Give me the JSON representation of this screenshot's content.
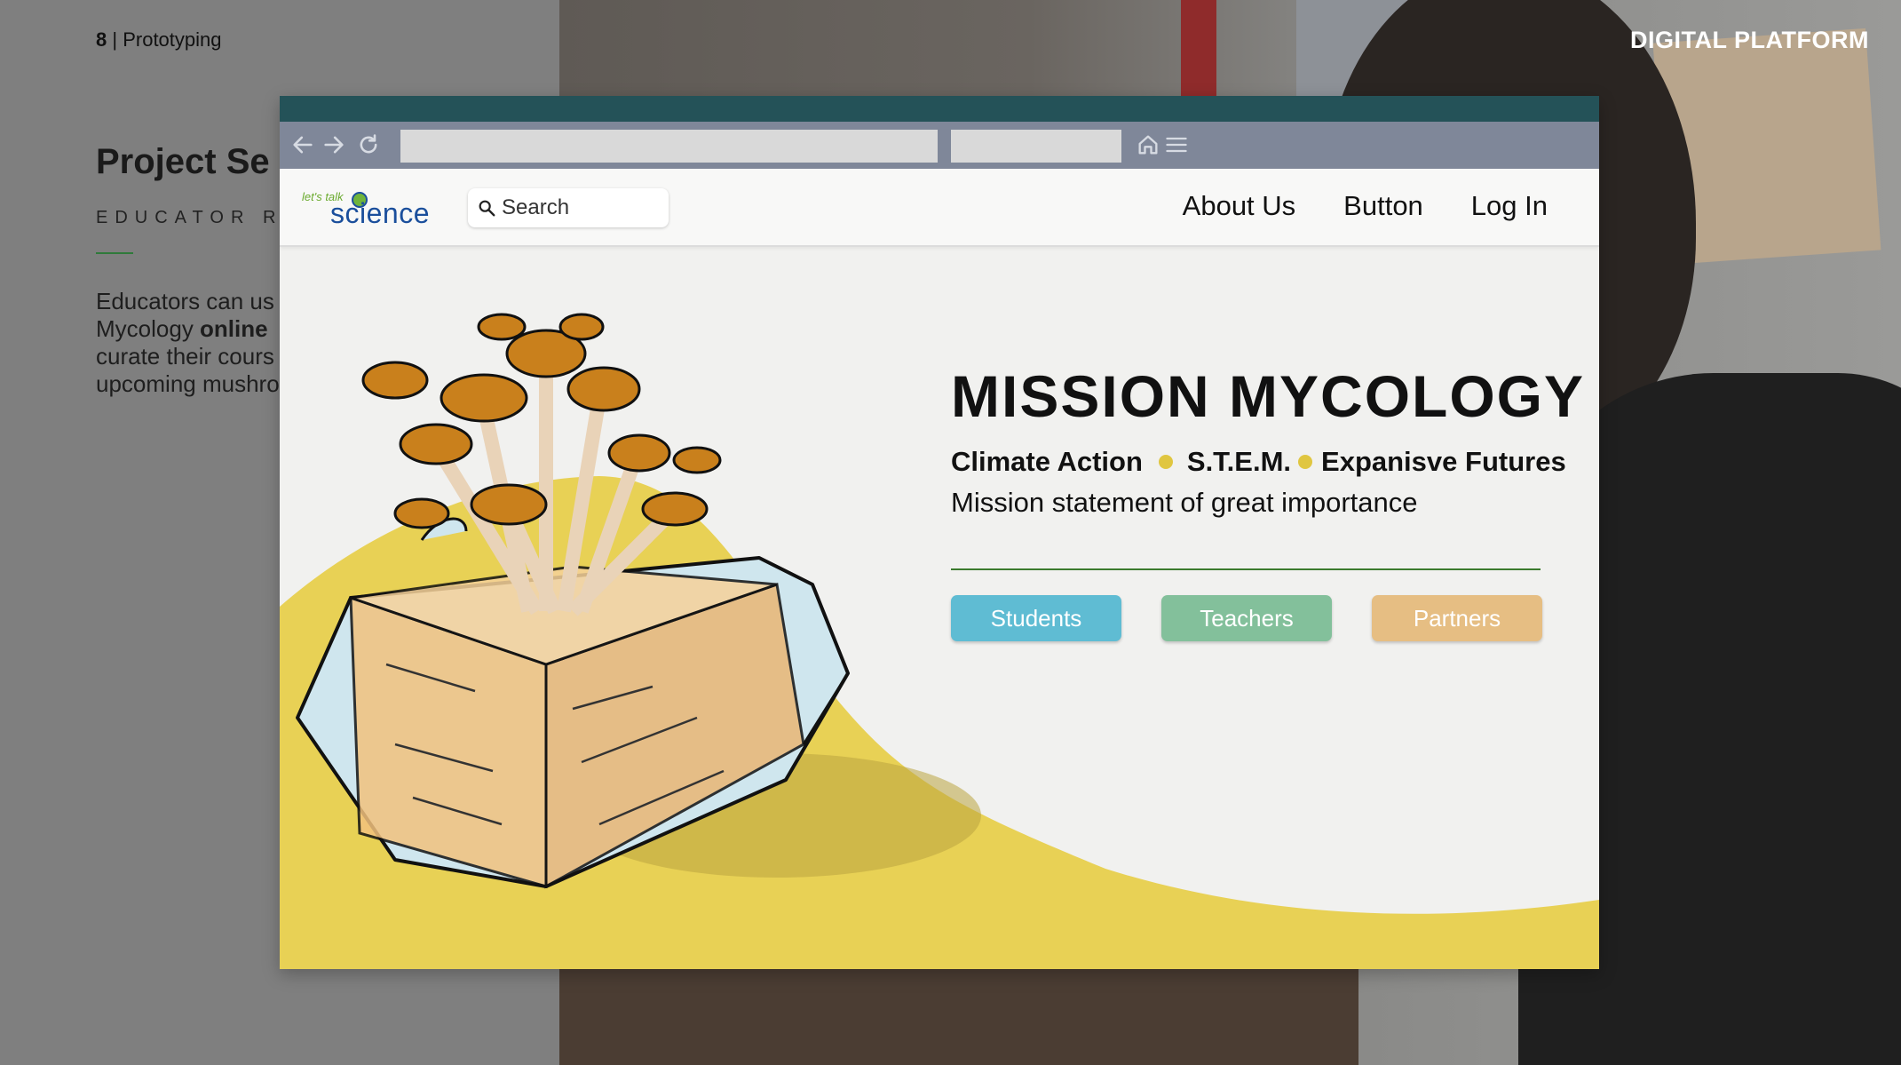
{
  "slide": {
    "page_number": "8",
    "page_section": "Prototyping",
    "title": "Project Se",
    "subtitle": "EDUCATOR RE",
    "body_line1": "Educators can us",
    "body_line2_a": "Mycology ",
    "body_line2_b": "online",
    "body_line3": "curate their cours",
    "body_line4": "upcoming mushro",
    "corner_label": "DIGITAL PLATFORM"
  },
  "site": {
    "logo_top": "let's talk",
    "logo_main": "science",
    "search_placeholder": "Search",
    "nav": [
      "About Us",
      "Button",
      "Log In"
    ],
    "hero": {
      "title": "MISSION MYCOLOGY",
      "tag1": "Climate Action",
      "tag2": "S.T.E.M.",
      "tag3": "Expanisve Futures",
      "mission": "Mission statement of great importance"
    },
    "buttons": [
      "Students",
      "Teachers",
      "Partners"
    ]
  },
  "colors": {
    "topbar": "#245258",
    "toolbar": "#7f8799",
    "wave_yellow": "#e8d155",
    "students": "#5fbcd3",
    "teachers": "#83c09b",
    "partners": "#e6be83"
  },
  "icons": [
    "back-arrow-icon",
    "forward-arrow-icon",
    "reload-icon",
    "home-icon",
    "menu-icon",
    "search-icon",
    "mushroom-kit-illustration"
  ]
}
